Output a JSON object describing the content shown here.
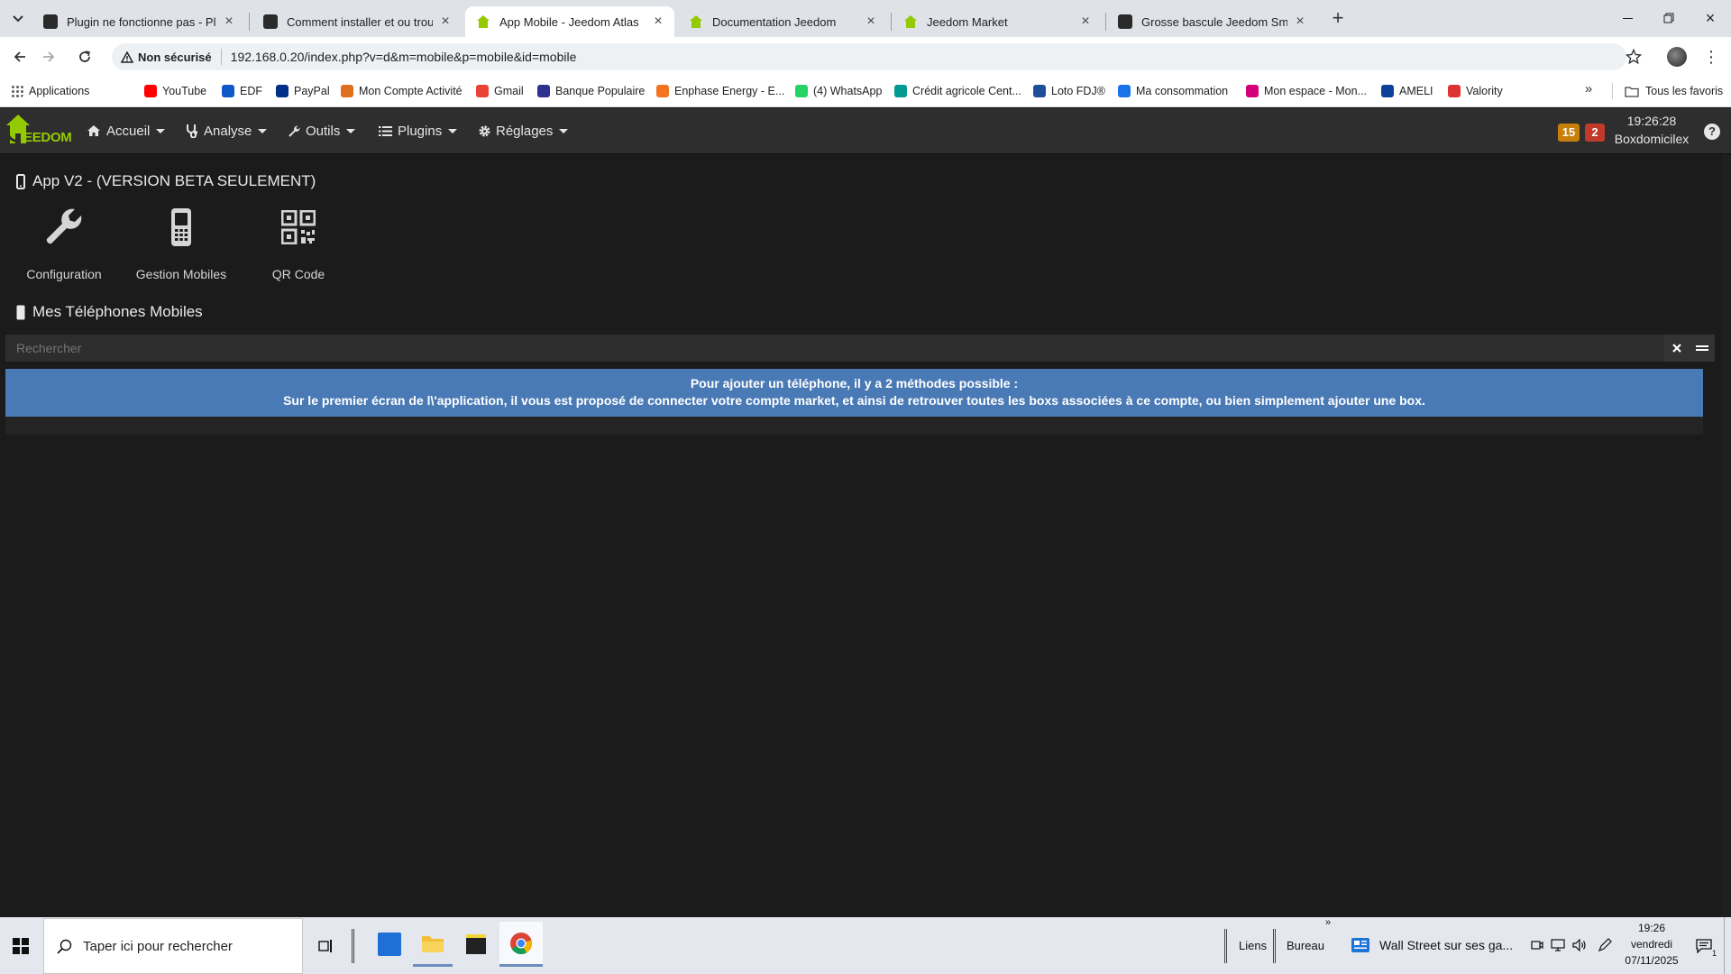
{
  "browser": {
    "tabs": [
      {
        "title": "Plugin ne fonctionne pas - Plug",
        "active": false
      },
      {
        "title": "Comment installer et ou trouve",
        "active": false
      },
      {
        "title": "App Mobile - Jeedom Atlas",
        "active": true
      },
      {
        "title": "Documentation Jeedom",
        "active": false
      },
      {
        "title": "Jeedom Market",
        "active": false
      },
      {
        "title": "Grosse bascule Jeedom Smart (",
        "active": false
      }
    ],
    "security_label": "Non sécurisé",
    "url": "192.168.0.20/index.php?v=d&m=mobile&p=mobile&id=mobile",
    "bookmarks": [
      {
        "label": "Applications",
        "icon": "apps-grid-icon",
        "color": "#5f6368"
      },
      {
        "label": "YouTube",
        "icon": "youtube-icon",
        "color": "#ff0000"
      },
      {
        "label": "EDF",
        "icon": "edf-icon",
        "color": "#1057c8"
      },
      {
        "label": "PayPal",
        "icon": "paypal-icon",
        "color": "#003087"
      },
      {
        "label": "Mon Compte Activité",
        "icon": "caf-icon",
        "color": "#e0701e"
      },
      {
        "label": "Gmail",
        "icon": "gmail-icon",
        "color": "#ea4335"
      },
      {
        "label": "Banque Populaire",
        "icon": "banque-populaire-icon",
        "color": "#2e3192"
      },
      {
        "label": "Enphase Energy - E...",
        "icon": "enphase-icon",
        "color": "#f37321"
      },
      {
        "label": "(4) WhatsApp",
        "icon": "whatsapp-icon",
        "color": "#25d366"
      },
      {
        "label": "Crédit agricole Cent...",
        "icon": "credit-agricole-icon",
        "color": "#009a93"
      },
      {
        "label": "Loto FDJ®",
        "icon": "fdj-icon",
        "color": "#1c4e9c"
      },
      {
        "label": "Ma consommation",
        "icon": "location-pin-icon",
        "color": "#1a73e8"
      },
      {
        "label": "Mon espace - Mon...",
        "icon": "monespace-icon",
        "color": "#d4007a"
      },
      {
        "label": "AMELI",
        "icon": "ameli-icon",
        "color": "#0c419a"
      },
      {
        "label": "Valority",
        "icon": "valority-icon",
        "color": "#d33"
      }
    ],
    "all_bookmarks_label": "Tous les favoris"
  },
  "jeedom": {
    "logo_text": "EEDOM",
    "menu": [
      {
        "label": "Accueil",
        "icon": "home-icon"
      },
      {
        "label": "Analyse",
        "icon": "stethoscope-icon"
      },
      {
        "label": "Outils",
        "icon": "wrench-icon"
      },
      {
        "label": "Plugins",
        "icon": "list-icon"
      },
      {
        "label": "Réglages",
        "icon": "cogs-icon"
      }
    ],
    "badge_orange": "15",
    "badge_red": "2",
    "time": "19:26:28",
    "box_name": "Boxdomicilex",
    "colors": {
      "accent": "#94ca02",
      "badge_orange": "#c87f0a",
      "badge_red": "#c0392b",
      "alert": "#4a7ab5"
    }
  },
  "content": {
    "page_title": "App V2 - (VERSION BETA SEULEMENT)",
    "cards": [
      {
        "label": "Configuration",
        "icon": "wrench-icon"
      },
      {
        "label": "Gestion Mobiles",
        "icon": "mobile-icon"
      },
      {
        "label": "QR Code",
        "icon": "qrcode-icon"
      }
    ],
    "section_title": "Mes Téléphones Mobiles",
    "search_placeholder": "Rechercher",
    "alert_line1": "Pour ajouter un téléphone, il y a 2 méthodes possible :",
    "alert_line2": "Sur le premier écran de l\\'application, il vous est proposé de connecter votre compte market, et ainsi de retrouver toutes les boxs associées à ce compte, ou bien simplement ajouter une box."
  },
  "taskbar": {
    "search_placeholder": "Taper ici pour rechercher",
    "links_label": "Liens",
    "desktop_label": "Bureau",
    "news_label": "Wall Street sur ses ga...",
    "time": "19:26",
    "day": "vendredi",
    "date": "07/11/2025",
    "notification_count": "1"
  }
}
